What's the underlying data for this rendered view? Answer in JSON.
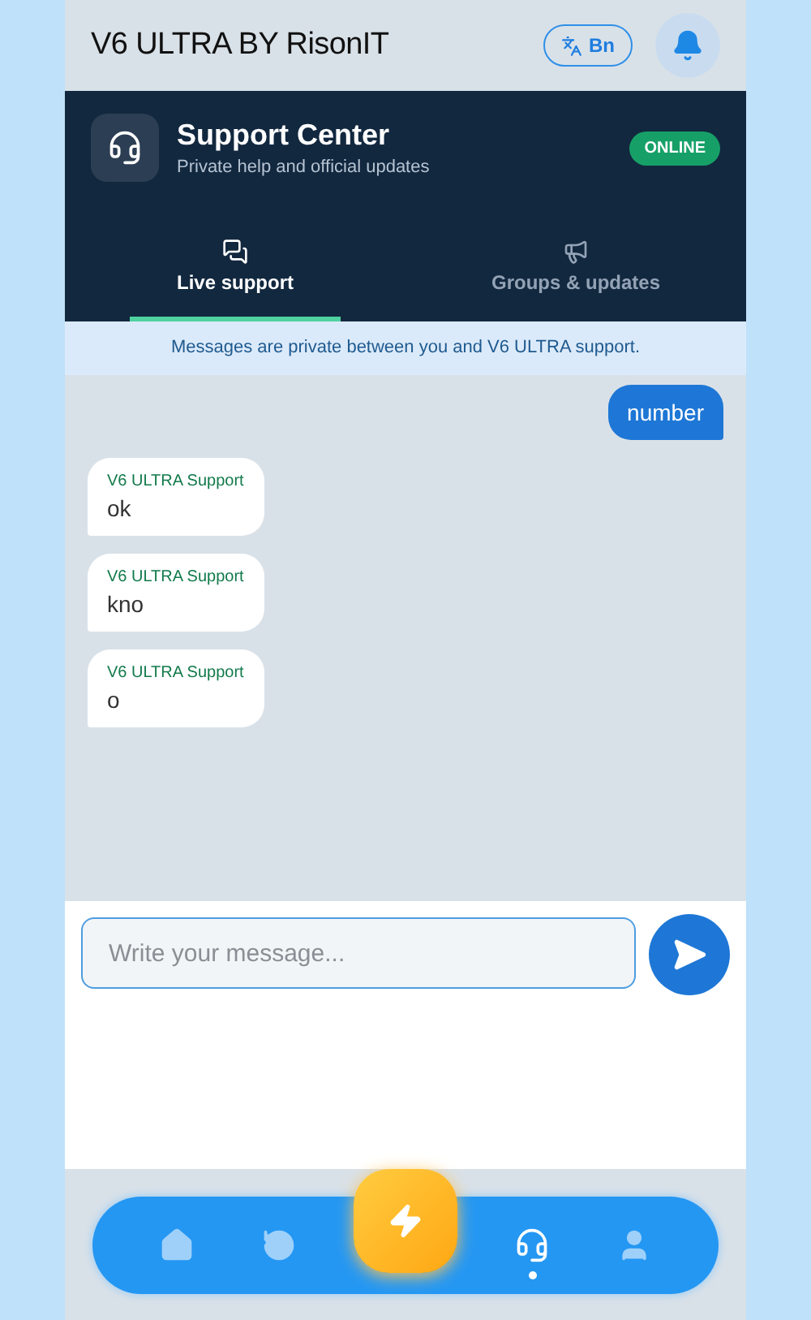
{
  "header": {
    "title": "V6 ULTRA BY RisonIT",
    "language_button": "Bn"
  },
  "support_panel": {
    "title": "Support Center",
    "subtitle": "Private help and official updates",
    "status": "ONLINE"
  },
  "tabs": [
    {
      "label": "Live support",
      "selected": true
    },
    {
      "label": "Groups & updates",
      "selected": false
    }
  ],
  "notice": "Messages are private between you and V6 ULTRA support.",
  "messages": [
    {
      "kind": "outgoing",
      "text": "number"
    },
    {
      "kind": "incoming",
      "sender": "V6 ULTRA Support",
      "text": "ok"
    },
    {
      "kind": "incoming",
      "sender": "V6 ULTRA Support",
      "text": "kno"
    },
    {
      "kind": "incoming",
      "sender": "V6 ULTRA Support",
      "text": "o"
    }
  ],
  "composer": {
    "placeholder": "Write your message..."
  },
  "bottom_nav": [
    {
      "selected": false
    },
    {
      "selected": false
    },
    {
      "selected": false
    },
    {
      "selected": true
    },
    {
      "selected": false
    }
  ]
}
